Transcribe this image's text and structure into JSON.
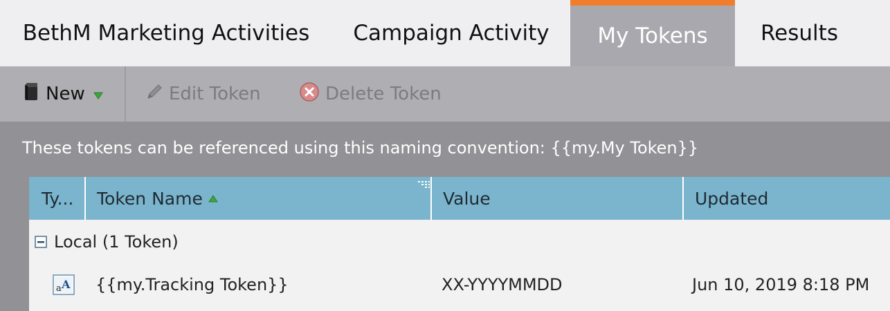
{
  "tabs": [
    {
      "label": "BethM Marketing Activities"
    },
    {
      "label": "Campaign Activity"
    },
    {
      "label": "My Tokens"
    },
    {
      "label": "Results"
    }
  ],
  "colors": {
    "active_tab_accent": "#ef7d2c",
    "grid_header": "#7bb5cd",
    "sort_indicator": "#3ca63c"
  },
  "toolbar": {
    "new_label": "New",
    "new_icon": "book-icon",
    "edit_label": "Edit Token",
    "edit_icon": "pencil-icon",
    "delete_label": "Delete Token",
    "delete_icon": "delete-x-icon"
  },
  "hint_text": "These tokens can be referenced using this naming convention: {{my.My Token}}",
  "grid": {
    "columns": [
      "Ty...",
      "Token Name",
      "Value",
      "Updated"
    ],
    "group_label": "Local (1 Token)",
    "rows": [
      {
        "type_icon": "text-token-icon",
        "token_name": "{{my.Tracking Token}}",
        "value": "XX-YYYYMMDD",
        "updated": "Jun 10, 2019 8:18 PM"
      }
    ]
  }
}
